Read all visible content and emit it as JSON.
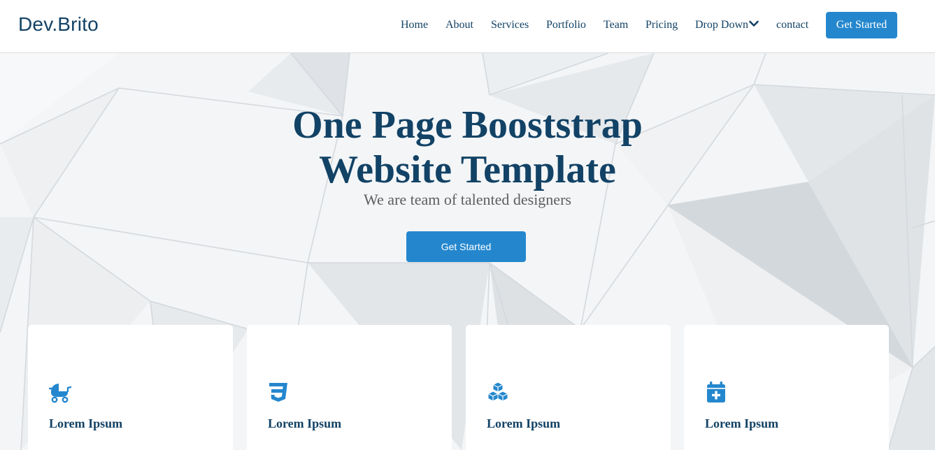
{
  "header": {
    "logo": "Dev.Brito",
    "nav": [
      {
        "label": "Home"
      },
      {
        "label": "About"
      },
      {
        "label": "Services"
      },
      {
        "label": "Portfolio"
      },
      {
        "label": "Team"
      },
      {
        "label": "Pricing"
      },
      {
        "label": "Drop Down"
      },
      {
        "label": "contact"
      }
    ],
    "cta_label": "Get Started"
  },
  "hero": {
    "title_line1": "One Page Booststrap",
    "title_line2": "Website Template",
    "subtitle": "We are team of talented designers",
    "button_label": "Get Started"
  },
  "cards": [
    {
      "icon": "baby-carriage-icon",
      "title": "Lorem Ipsum"
    },
    {
      "icon": "css3-icon",
      "title": "Lorem Ipsum"
    },
    {
      "icon": "cubes-icon",
      "title": "Lorem Ipsum"
    },
    {
      "icon": "calendar-plus-icon",
      "title": "Lorem Ipsum"
    }
  ],
  "colors": {
    "primary": "#2487ce",
    "heading": "#124265",
    "subtitle": "#5e5e5e"
  }
}
